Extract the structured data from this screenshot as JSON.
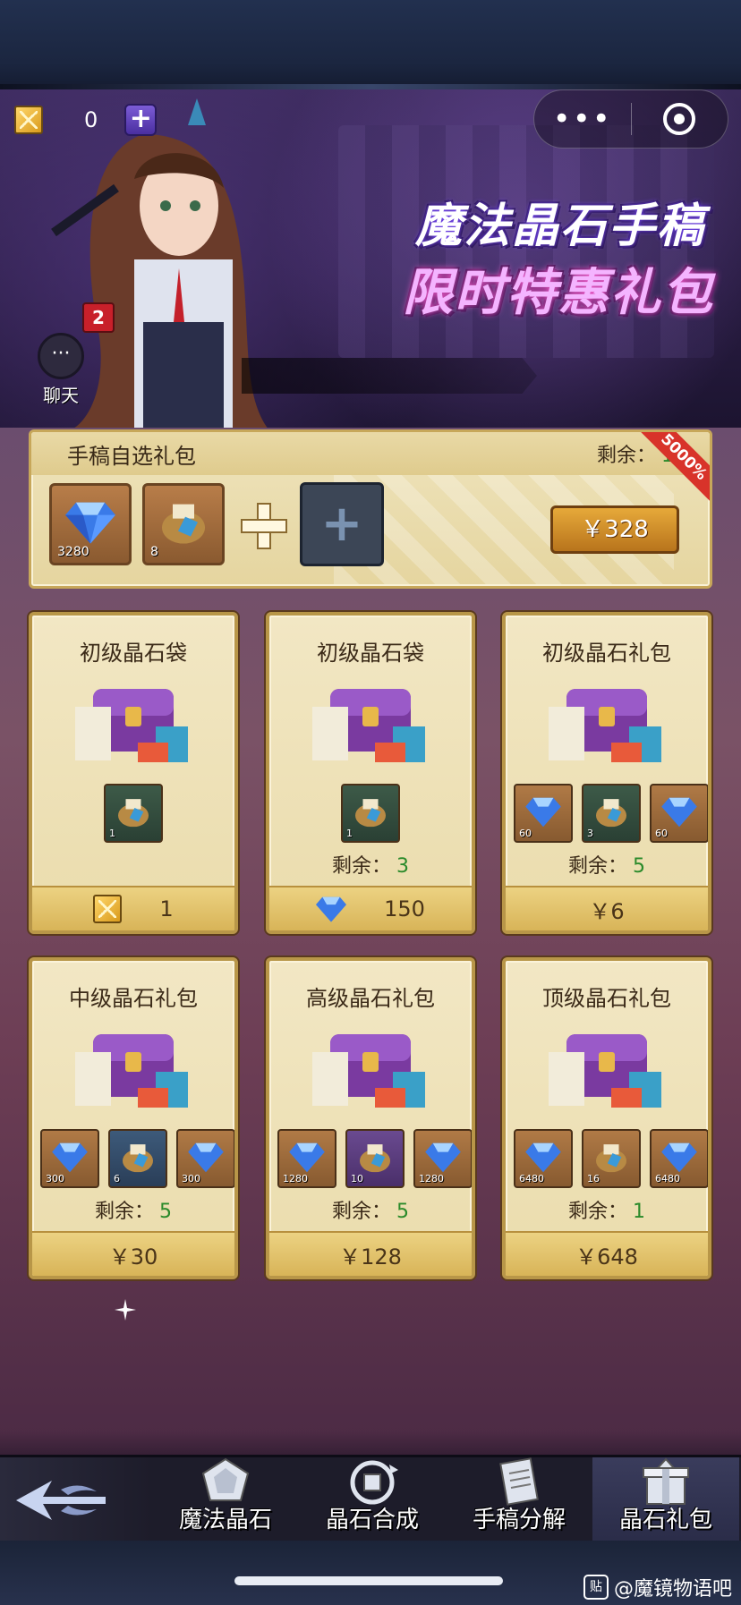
{
  "header": {
    "currency_value": "0",
    "plus_symbol": "+",
    "more_symbol": "•••"
  },
  "banner": {
    "title_line1": "魔法晶石手稿",
    "title_line2": "限时特惠礼包"
  },
  "chat": {
    "label": "聊天",
    "badge": "2"
  },
  "gift_pack": {
    "title": "手稿自选礼包",
    "remain_label": "剩余：",
    "remain_value": "1",
    "ribbon": "5000%",
    "items": [
      {
        "icon": "blue-crystal-icon",
        "count": "3280"
      },
      {
        "icon": "manuscript-bag-icon",
        "count": "8"
      }
    ],
    "price": "￥328"
  },
  "cards": [
    {
      "title": "初级晶石袋",
      "items": [
        {
          "icon": "manuscript-bag-icon",
          "count": "1"
        }
      ],
      "remain_label": "",
      "remain_value": "",
      "cost_icon": "crystal-token-icon",
      "cost": "1"
    },
    {
      "title": "初级晶石袋",
      "items": [
        {
          "icon": "manuscript-bag-icon",
          "count": "1"
        }
      ],
      "remain_label": "剩余：",
      "remain_value": "3",
      "cost_icon": "blue-crystal-icon",
      "cost": "150"
    },
    {
      "title": "初级晶石礼包",
      "items": [
        {
          "icon": "blue-crystal-icon",
          "count": "60"
        },
        {
          "icon": "manuscript-bag-icon",
          "count": "3"
        },
        {
          "icon": "blue-crystal-icon",
          "count": "60"
        }
      ],
      "remain_label": "剩余：",
      "remain_value": "5",
      "cost_icon": "",
      "cost": "￥6"
    },
    {
      "title": "中级晶石礼包",
      "items": [
        {
          "icon": "blue-crystal-icon",
          "count": "300"
        },
        {
          "icon": "manuscript-bag-icon",
          "count": "6"
        },
        {
          "icon": "blue-crystal-icon",
          "count": "300"
        }
      ],
      "remain_label": "剩余：",
      "remain_value": "5",
      "cost_icon": "",
      "cost": "￥30"
    },
    {
      "title": "高级晶石礼包",
      "items": [
        {
          "icon": "blue-crystal-icon",
          "count": "1280"
        },
        {
          "icon": "manuscript-bag-icon",
          "count": "10"
        },
        {
          "icon": "blue-crystal-icon",
          "count": "1280"
        }
      ],
      "remain_label": "剩余：",
      "remain_value": "5",
      "cost_icon": "",
      "cost": "￥128"
    },
    {
      "title": "顶级晶石礼包",
      "items": [
        {
          "icon": "blue-crystal-icon",
          "count": "6480"
        },
        {
          "icon": "manuscript-bag-icon",
          "count": "16"
        },
        {
          "icon": "blue-crystal-icon",
          "count": "6480"
        }
      ],
      "remain_label": "剩余：",
      "remain_value": "1",
      "cost_icon": "",
      "cost": "￥648"
    }
  ],
  "nav": {
    "items": [
      {
        "label": "魔法晶石",
        "icon": "magic-crystal-icon"
      },
      {
        "label": "晶石合成",
        "icon": "crystal-synthesis-icon"
      },
      {
        "label": "手稿分解",
        "icon": "manuscript-decompose-icon"
      },
      {
        "label": "晶石礼包",
        "icon": "crystal-gift-icon"
      }
    ],
    "active_index": 3
  },
  "watermark": {
    "logo": "贴",
    "text": "@魔镜物语吧"
  },
  "colors": {
    "remain_green": "#2a8a2a",
    "gold_border": "#b89648",
    "price_orange": "#d99a2c"
  }
}
